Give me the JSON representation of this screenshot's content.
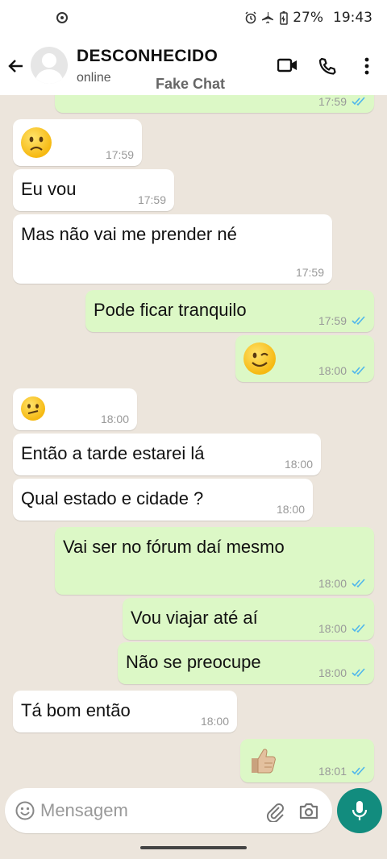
{
  "status_bar": {
    "battery": "27%",
    "time": "19:43"
  },
  "header": {
    "contact_name": "DESCONHECIDO",
    "status": "online",
    "watermark": "Fake Chat"
  },
  "messages": [
    {
      "dir": "out",
      "text": "",
      "time": "17:59",
      "read": true
    },
    {
      "dir": "in",
      "emoji": "slightly-frowning-face",
      "time": "17:59"
    },
    {
      "dir": "in",
      "text": "Eu vou",
      "time": "17:59"
    },
    {
      "dir": "in",
      "text": "Mas não vai me prender né",
      "time": "17:59"
    },
    {
      "dir": "out",
      "text": "Pode ficar tranquilo",
      "time": "17:59",
      "read": true
    },
    {
      "dir": "out",
      "emoji": "winking-face",
      "time": "18:00",
      "read": true
    },
    {
      "dir": "in",
      "emoji": "confused-face",
      "time": "18:00"
    },
    {
      "dir": "in",
      "text": "Então a tarde estarei lá",
      "time": "18:00"
    },
    {
      "dir": "in",
      "text": "Qual estado e cidade ?",
      "time": "18:00"
    },
    {
      "dir": "out",
      "text": "Vai ser no fórum daí mesmo",
      "time": "18:00",
      "read": true
    },
    {
      "dir": "out",
      "text": "Vou viajar até aí",
      "time": "18:00",
      "read": true
    },
    {
      "dir": "out",
      "text": "Não se preocupe",
      "time": "18:00",
      "read": true
    },
    {
      "dir": "in",
      "text": "Tá bom então",
      "time": "18:00"
    },
    {
      "dir": "out",
      "emoji": "thumbs-up",
      "time": "18:01",
      "read": true
    }
  ],
  "input": {
    "placeholder": "Mensagem"
  },
  "colors": {
    "incoming": "#ffffff",
    "outgoing": "#dcf8c6",
    "background": "#ece5dc",
    "read_ticks": "#4fb6ec",
    "accent": "#128c7e"
  }
}
